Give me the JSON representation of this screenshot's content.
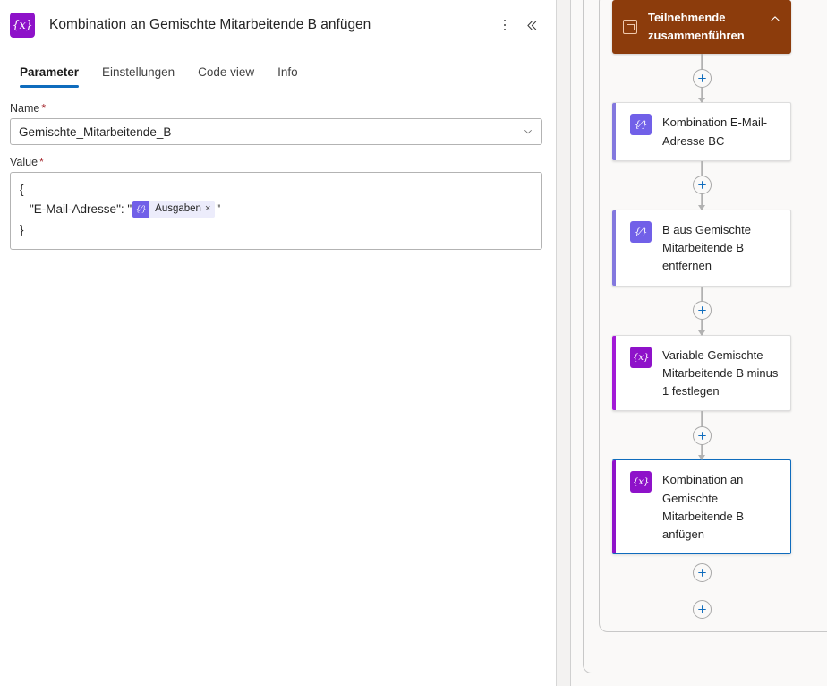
{
  "panel": {
    "icon": "variable-braces-icon",
    "title": "Kombination an Gemischte Mitarbeitende B anfügen",
    "more_options": "more-options-icon",
    "collapse": "collapse-panel-icon",
    "tabs": [
      {
        "label": "Parameter",
        "active": true
      },
      {
        "label": "Einstellungen",
        "active": false
      },
      {
        "label": "Code view",
        "active": false
      },
      {
        "label": "Info",
        "active": false
      }
    ],
    "fields": {
      "name": {
        "label": "Name",
        "required": "*",
        "value": "Gemischte_Mitarbeitende_B",
        "chevron": "chevron-down-icon"
      },
      "value": {
        "label": "Value",
        "required": "*",
        "line1": "{",
        "line2_prefix": "\"E-Mail-Adresse\": \"",
        "token": {
          "icon": "expression-icon",
          "label": "Ausgaben",
          "remove": "×"
        },
        "line2_suffix": "\"",
        "line3": "}"
      }
    }
  },
  "canvas": {
    "scope": {
      "icon": "scope-frame-icon",
      "title": "Teilnehmende zusammenführen",
      "collapse_icon": "chevron-up-icon",
      "color": "#8C3C0C"
    },
    "add_button_icon": "plus-icon",
    "nodes": [
      {
        "icon": "compose-expression-icon",
        "icon_glyph": "{⁄}",
        "icon_kind": "compose",
        "bar_color": "#8378DE",
        "title": "Kombination E-Mail-Adresse BC",
        "selected": false
      },
      {
        "icon": "compose-expression-icon",
        "icon_glyph": "{⁄}",
        "icon_kind": "compose",
        "bar_color": "#8378DE",
        "title": "B aus Gemischte Mitarbeitende B entfernen",
        "selected": false
      },
      {
        "icon": "set-variable-icon",
        "icon_glyph": "{x}",
        "icon_kind": "variable",
        "bar_color": "#A219D6",
        "title": "Variable Gemischte Mitarbeitende B minus 1 festlegen",
        "selected": false
      },
      {
        "icon": "set-variable-icon",
        "icon_glyph": "{x}",
        "icon_kind": "variable",
        "bar_color": "#8E12C9",
        "title": "Kombination an Gemischte Mitarbeitende B anfügen",
        "selected": true
      }
    ]
  },
  "colors": {
    "accent": "#0F6CBD",
    "scope_header": "#8C3C0C",
    "variable_purple": "#8E12C9",
    "compose_purple": "#7160E8",
    "required_red": "#a4262c",
    "canvas_bg": "#faf9f8"
  }
}
